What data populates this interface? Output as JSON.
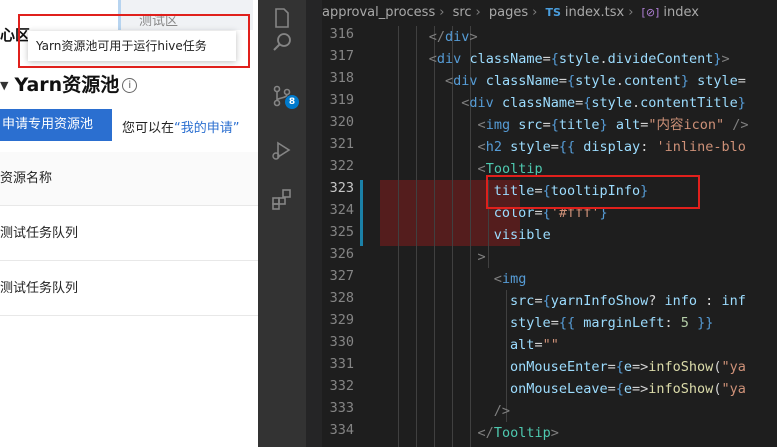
{
  "left_app": {
    "top_tab_label": "测试区",
    "header_title": "心区",
    "tooltip_text": "Yarn资源池可用于运行hive任务",
    "page_title": "Yarn资源池",
    "apply_button": "申请专用资源池",
    "apply_hint_prefix": "您可以在",
    "apply_hint_link": "“我的申请”",
    "table": {
      "header": "资源名称",
      "rows": [
        "测试任务队列",
        "测试任务队列"
      ]
    }
  },
  "vscode": {
    "breadcrumb": [
      "approval_process",
      "src",
      "pages",
      "index.tsx",
      "index"
    ],
    "breadcrumb_ts_icon": "TS",
    "breadcrumb_ns_icon": "[⊘]",
    "scm_badge": "8",
    "line_numbers": [
      316,
      317,
      318,
      319,
      320,
      321,
      322,
      323,
      324,
      325,
      326,
      327,
      328,
      329,
      330,
      331,
      332,
      333,
      334
    ],
    "active_line": 323,
    "accent_color": "#007acc",
    "highlight_color": "#e0201c"
  }
}
